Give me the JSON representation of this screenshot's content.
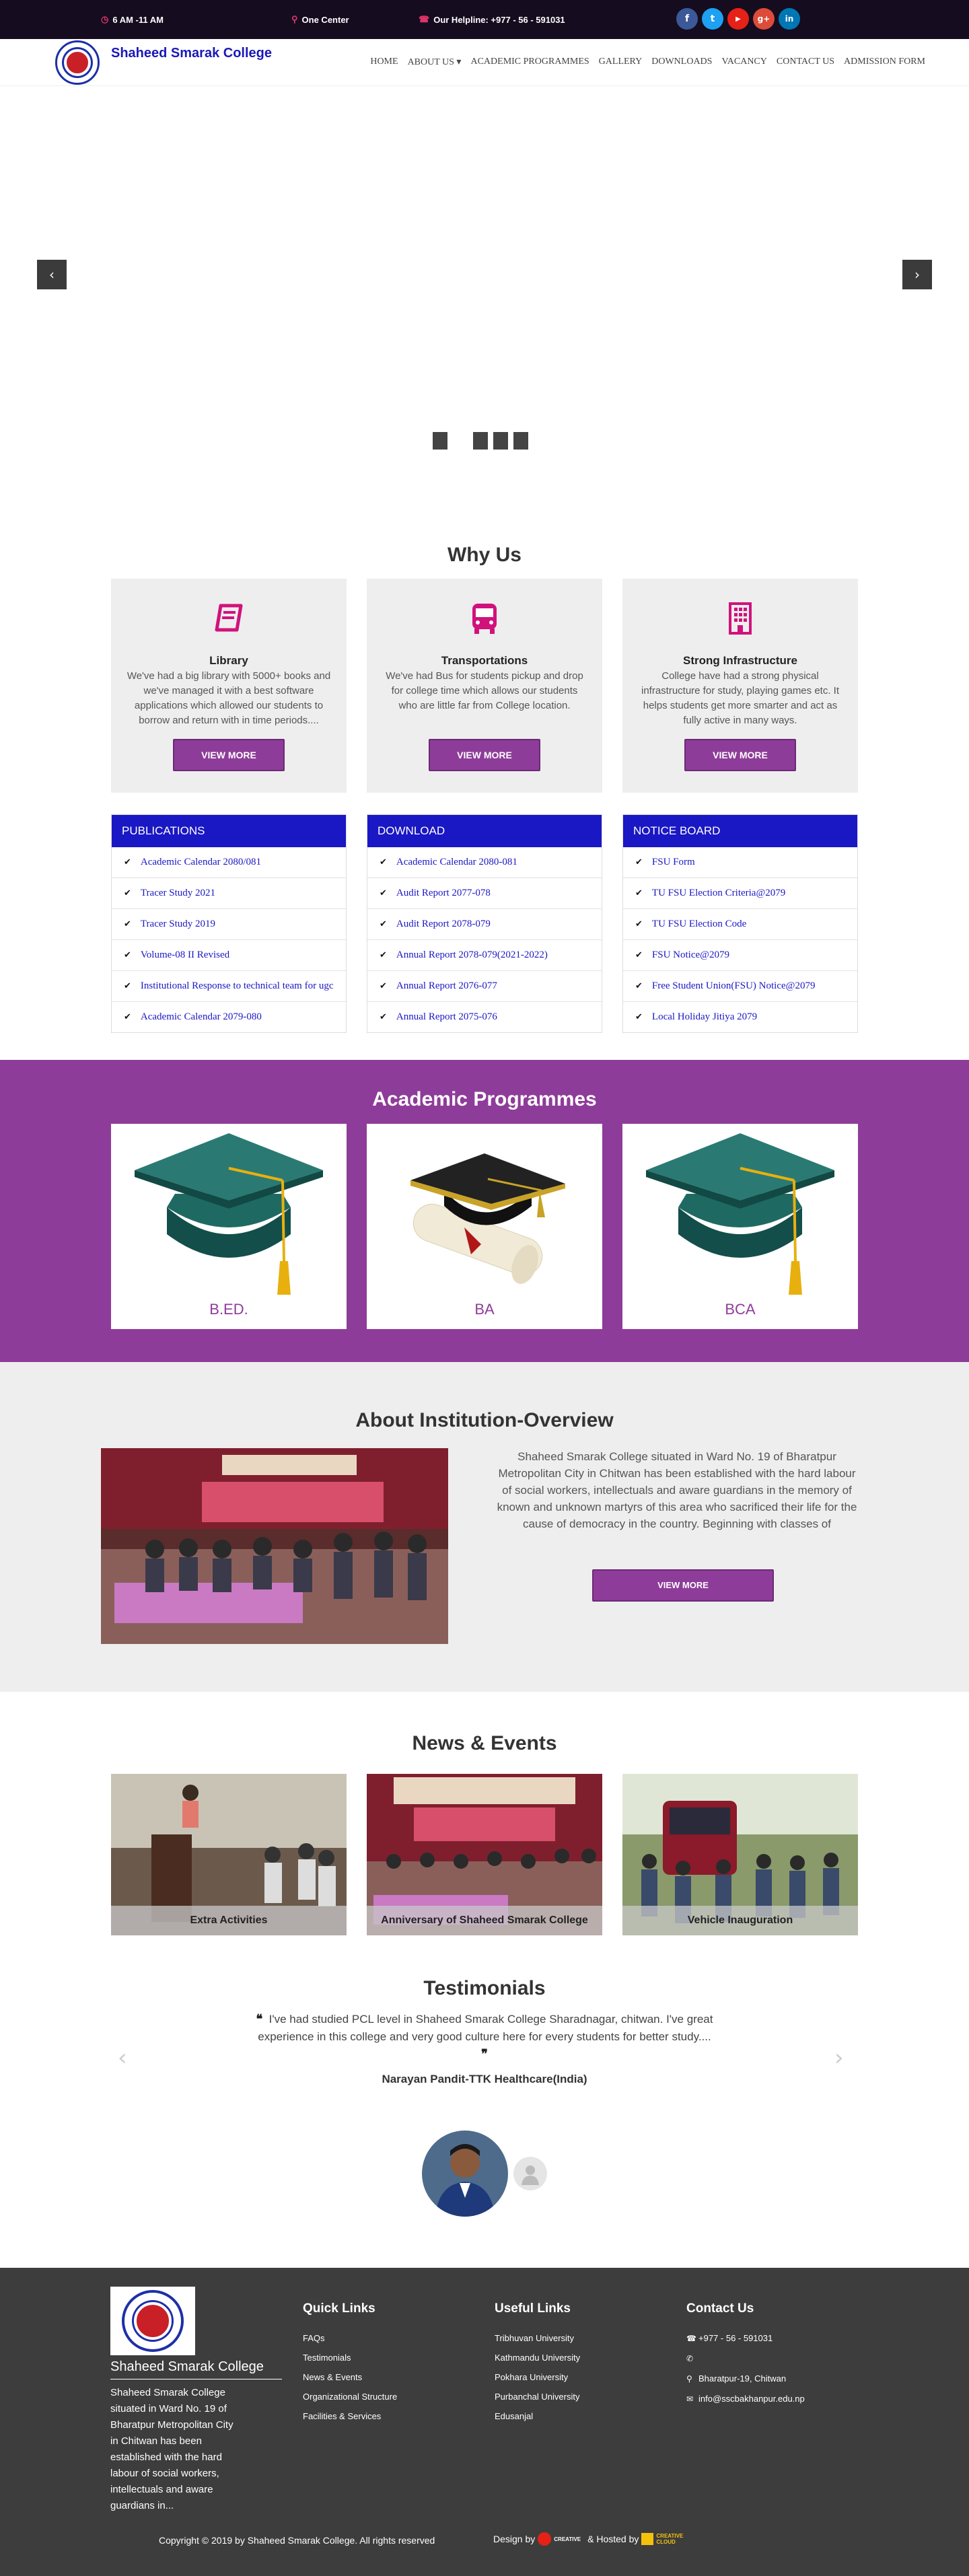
{
  "topbar": {
    "hours": "6 AM -11 AM",
    "location": "One Center",
    "helpline": "Our Helpline: +977 - 56 - 591031",
    "social": [
      {
        "icon": "facebook-icon",
        "glyph": "f",
        "color": "#3b5998"
      },
      {
        "icon": "twitter-icon",
        "glyph": "t",
        "color": "#1da1f2"
      },
      {
        "icon": "youtube-icon",
        "glyph": "▶",
        "color": "#e62117"
      },
      {
        "icon": "google-plus-icon",
        "glyph": "g+",
        "color": "#dd4b39"
      },
      {
        "icon": "linkedin-icon",
        "glyph": "in",
        "color": "#0077b5"
      }
    ]
  },
  "header": {
    "brand": "Shaheed Smarak College",
    "nav": [
      "HOME",
      "ABOUT US ▾",
      "ACADEMIC PROGRAMMES",
      "GALLERY",
      "DOWNLOADS",
      "VACANCY",
      "CONTACT US",
      "ADMISSION FORM"
    ]
  },
  "slider": {
    "prev": "‹",
    "next": "›",
    "slides": 4
  },
  "why": {
    "title": "Why Us",
    "cards": [
      {
        "icon": "book-icon",
        "title": "Library",
        "text": "We've had a big library with 5000+ books and we've managed it with a best software applications which allowed our students to borrow and return with in time periods....",
        "button": "VIEW MORE"
      },
      {
        "icon": "bus-icon",
        "title": "Transportations",
        "text": "We've had Bus for students pickup and drop for college time which allows our students who are little far from College location.",
        "button": "VIEW MORE"
      },
      {
        "icon": "building-icon",
        "title": "Strong Infrastructure",
        "text": "College have had a strong physical infrastructure for study, playing games etc. It helps students get more smarter and act as fully active in many ways.",
        "button": "VIEW MORE"
      }
    ]
  },
  "lists": [
    {
      "title": "PUBLICATIONS",
      "items": [
        "Academic Calendar 2080/081",
        "Tracer Study 2021",
        "Tracer Study 2019",
        "Volume-08 II Revised",
        "Institutional Response to technical team for ugc",
        "Academic Calendar 2079-080"
      ]
    },
    {
      "title": "DOWNLOAD",
      "items": [
        "Academic Calendar 2080-081",
        "Audit Report 2077-078",
        "Audit Report 2078-079",
        "Annual Report 2078-079(2021-2022)",
        "Annual Report 2076-077",
        "Annual Report 2075-076"
      ]
    },
    {
      "title": "NOTICE BOARD",
      "items": [
        "FSU Form",
        "TU FSU Election Criteria@2079",
        "TU FSU Election Code",
        "FSU Notice@2079",
        "Free Student Union(FSU) Notice@2079",
        "Local Holiday Jitiya 2079"
      ]
    }
  ],
  "academic": {
    "title": "Academic Programmes",
    "programs": [
      "B.ED.",
      "BA",
      "BCA"
    ]
  },
  "about": {
    "title": "About Institution-Overview",
    "text": "Shaheed Smarak College situated in Ward No. 19 of Bharatpur Metropolitan City in Chitwan has been established with the hard labour of social workers, intellectuals and aware guardians in the memory of known and unknown martyrs of this area who sacrificed their life for the cause of democracy in the country. Beginning with classes of",
    "button": "VIEW MORE"
  },
  "news": {
    "title": "News & Events",
    "items": [
      "Extra Activities",
      "Anniversary of Shaheed Smarak College",
      "Vehicle Inauguration"
    ]
  },
  "testimonials": {
    "title": "Testimonials",
    "open_quote": "❝",
    "close_quote": "❞",
    "quote": "I've had studied PCL level in Shaheed Smarak College Sharadnagar, chitwan. I've great experience in this college and very good culture here for every students for better study....",
    "name": "Narayan Pandit-TTK Healthcare(India)",
    "prev": "‹",
    "next": "›"
  },
  "footer": {
    "about_title": "Shaheed Smarak College",
    "about_text": "Shaheed Smarak College situated in Ward No. 19 of Bharatpur Metropolitan City in Chitwan has been established with the hard labour of social workers, intellectuals and aware guardians in...",
    "quick_title": "Quick Links",
    "quick": [
      "FAQs",
      "Testimonials",
      "News & Events",
      "Organizational Structure",
      "Facilities & Services"
    ],
    "useful_title": "Useful Links",
    "useful": [
      "Tribhuvan University",
      "Kathmandu University",
      "Pokhara University",
      "Purbanchal University",
      "Edusanjal"
    ],
    "contact_title": "Contact Us",
    "contact": [
      {
        "icon": "phone-icon",
        "glyph": "☎",
        "text": "+977 - 56 - 591031"
      },
      {
        "icon": "phone-icon",
        "glyph": "✆",
        "text": ""
      },
      {
        "icon": "map-marker-icon",
        "glyph": "⚲",
        "text": "Bharatpur-19, Chitwan"
      },
      {
        "icon": "envelope-icon",
        "glyph": "✉",
        "text": "info@sscbakhanpur.edu.np"
      }
    ],
    "copyright": "Copyright © 2019 by Shaheed Smarak College. All rights reserved",
    "design_by": "Design by",
    "design_word": "CREATIVE",
    "hosted_by": "& Hosted by",
    "host_word": "CREATIVE CLOUD"
  }
}
